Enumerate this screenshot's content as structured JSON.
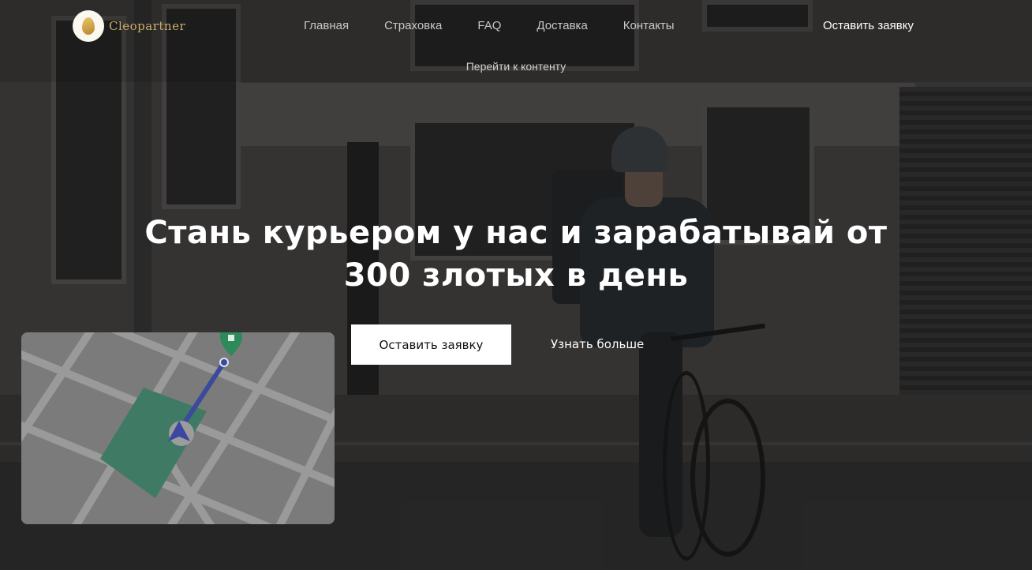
{
  "header": {
    "logo_text": "Cleopartner",
    "nav": [
      "Главная",
      "Страховка",
      "FAQ",
      "Доставка",
      "Контакты"
    ],
    "cta": "Оставить заявку",
    "skip_link": "Перейти к контенту"
  },
  "hero": {
    "headline_line1": "Стань курьером у нас и зарабатывай от",
    "headline_line2": "300 злотых в день",
    "primary_button": "Оставить заявку",
    "secondary_link": "Узнать больше"
  },
  "colors": {
    "logo_gold": "#c9ae6b",
    "map_route": "#3d4a9c",
    "map_park": "#3f7a64",
    "map_pin": "#2e8a5a"
  }
}
